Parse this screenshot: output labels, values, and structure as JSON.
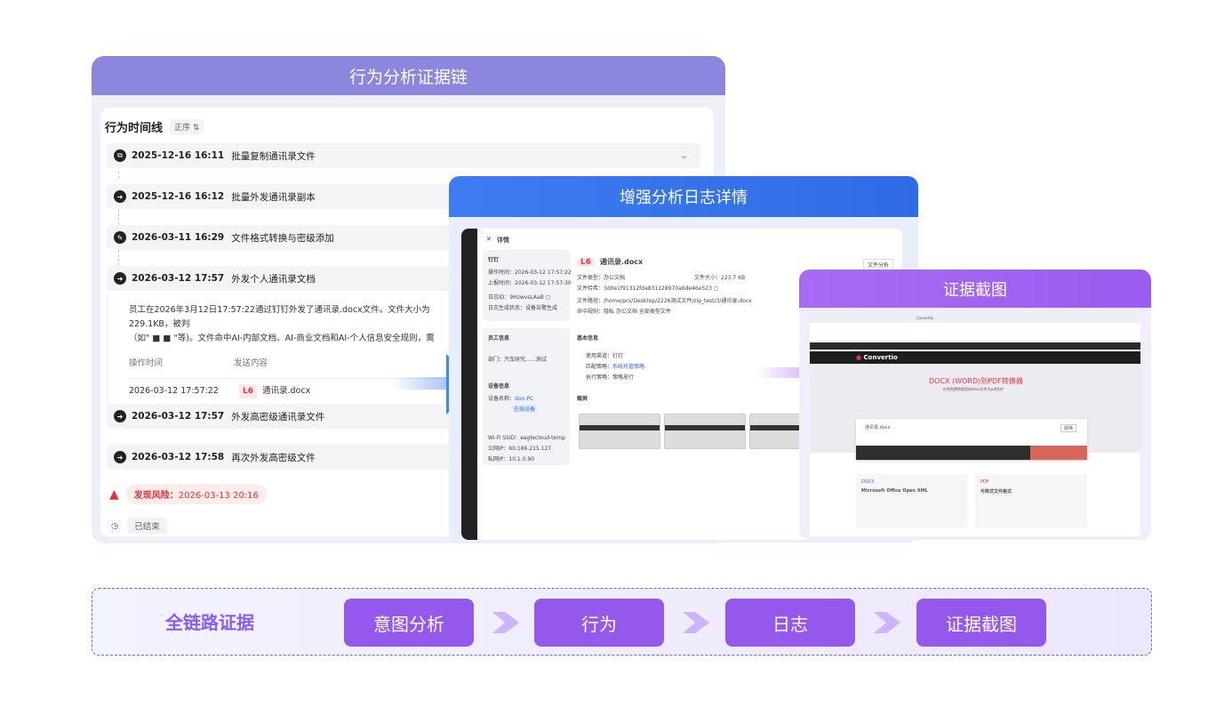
{
  "panel1": {
    "title": "行为分析证据链",
    "timeline_title": "行为时间线",
    "sort_label": "正序 ⇅",
    "events": [
      {
        "datetime": "2025-12-16 16:11",
        "label": "批量复制通讯录文件"
      },
      {
        "datetime": "2025-12-16 16:12",
        "label": "批量外发通讯录副本"
      },
      {
        "datetime": "2026-03-11 16:29",
        "label": "文件格式转换与密级添加"
      },
      {
        "datetime": "2026-03-12 17:57",
        "label": "外发个人通讯录文档"
      },
      {
        "datetime": "2026-03-12 17:57",
        "label": "外发高密级通讯录文件"
      },
      {
        "datetime": "2026-03-12 17:58",
        "label": "再次外发高密级文件"
      }
    ],
    "detail_line1": "员工在2026年3月12日17:57:22通过钉钉外发了通讯录.docx文件。文件大小为229.1KB，被判",
    "detail_line2": "（如\"          ■ ■ \"等)。文件命中AI-内部文档、AI-商业文档和AI-个人信息安全规则，需",
    "col_time": "操作时间",
    "col_content": "发送内容",
    "row_time": "2026-03-12 17:57:22",
    "row_level": "L6",
    "row_file": "通讯录.docx",
    "risk_label": "发现风险：",
    "risk_time": "2026-03-13 20:16",
    "end_label": "已结束"
  },
  "panel2": {
    "title": "增强分析日志详情",
    "close": "✕",
    "detail_word": "详情",
    "section_dingding": "钉钉",
    "op_time_label": "操作时间：",
    "op_time": "2026-03-12 17:57:22",
    "upload_time_label": "上报时间：",
    "upload_time": "2026-03-12 17:57:30",
    "log_label": "日志ID：",
    "log_id": "9HzwvsLAaB ▢",
    "source_label": "日志生成状态：",
    "source_value": "设备告警生成",
    "file_level": "L6",
    "file_name": "通讯录.docx",
    "file_type_label": "文件类型：",
    "file_type": "办公文档",
    "file_size_label": "文件大小：",
    "file_size": "223.7 KB",
    "hash_label": "文件哈希：",
    "hash": "3d0e1f91312fda831228970a6de46e523 ▢",
    "path_label": "文件路径：",
    "path": "/home/pcs/Desktop/2226测试文件/zip_test/3/通讯录.docx",
    "hit_label": "命中规则：",
    "hits": [
      "隐私",
      "办公文档",
      "全部类型文件"
    ],
    "analyze_btn": "文件分析",
    "employee_section": "员工信息",
    "basic_section": "基本信息",
    "device_section": "设备信息",
    "screenshot_section": "截屏",
    "dept_label": "部门：",
    "dept": "汽车研究……测试",
    "app_label": "使用渠道：",
    "app": "钉钉",
    "rule_label": "匹配策略：",
    "rule": "系统托管策略",
    "action_label": "执行策略：",
    "action": "策略放行",
    "device_label": "设备名称：",
    "device": "doo-PC",
    "device_tag": "在线设备",
    "wifi_label": "Wi-Fi SSID：",
    "wifi": "eaglecloud-temp",
    "ip_label": "公网IP：",
    "ip": "60.186.215.127",
    "lan_label": "私网IP：",
    "lan": "10.1.0.90"
  },
  "panel3": {
    "title": "证据截图",
    "tab_label": "Convertio",
    "brand": "Convertio",
    "headline": "DOCX (WORD)到PDF转换器",
    "subline": "在线免费转换您的docx文件为pdf文件",
    "file_row": "通讯录.docx",
    "convert_btn": "转换",
    "card1_title": "Microsoft Office Open XML",
    "card2_title": "可移式文件格式",
    "card1_tag": "DOCX",
    "card2_tag": "PDF"
  },
  "bottom": {
    "chain_label": "全链路证据",
    "steps": [
      "意图分析",
      "行为",
      "日志",
      "证据截图"
    ]
  }
}
